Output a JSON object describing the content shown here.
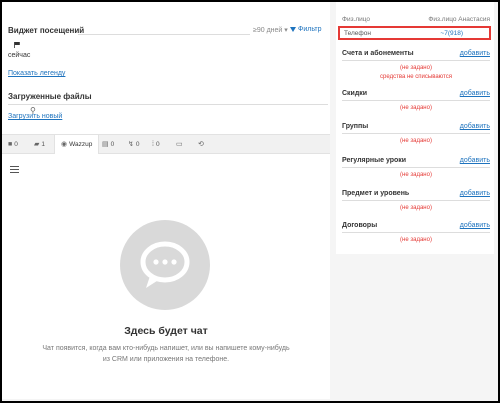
{
  "widget": {
    "title": "Виджет посещений",
    "period": "≥90 дней ▾",
    "filter": "Фильтр",
    "now": "сейчас",
    "legend_link": "Показать легенду"
  },
  "files": {
    "title": "Загруженные файлы",
    "upload_link": "Загрузить новый"
  },
  "tabs": [
    {
      "icon": "■",
      "label": "0"
    },
    {
      "icon": "▰",
      "label": "1"
    },
    {
      "icon": "◉",
      "label": "Wazzup"
    },
    {
      "icon": "▤",
      "label": "0"
    },
    {
      "icon": "↯",
      "label": "0"
    },
    {
      "icon": "⁞",
      "label": "0"
    },
    {
      "icon": "▭",
      "label": ""
    },
    {
      "icon": "⟲",
      "label": ""
    }
  ],
  "chat": {
    "title": "Здесь будет чат",
    "subtitle": "Чат появится, когда вам кто-нибудь напишет, или вы напишете кому-нибудь из CRM или приложения на телефоне."
  },
  "contact": {
    "type_label": "Физ.лицо",
    "name": "Физ.лицо Анастасия",
    "phone_label": "Телефон",
    "phone_value": "~7(918)"
  },
  "sections": [
    {
      "title": "Счета и абонементы",
      "add": "добавить",
      "notes": [
        "(не задано)",
        "средства не списываются"
      ]
    },
    {
      "title": "Скидки",
      "add": "добавить",
      "notes": [
        "(не задано)"
      ]
    },
    {
      "title": "Группы",
      "add": "добавить",
      "notes": [
        "(не задано)"
      ]
    },
    {
      "title": "Регулярные уроки",
      "add": "добавить",
      "notes": [
        "(не задано)"
      ]
    },
    {
      "title": "Предмет и уровень",
      "add": "добавить",
      "notes": [
        "(не задано)"
      ]
    },
    {
      "title": "Договоры",
      "add": "добавить",
      "notes": [
        "(не задано)"
      ]
    }
  ],
  "colors": {
    "link": "#1e73be",
    "warning": "#e53935",
    "highlight": "#e53935"
  }
}
